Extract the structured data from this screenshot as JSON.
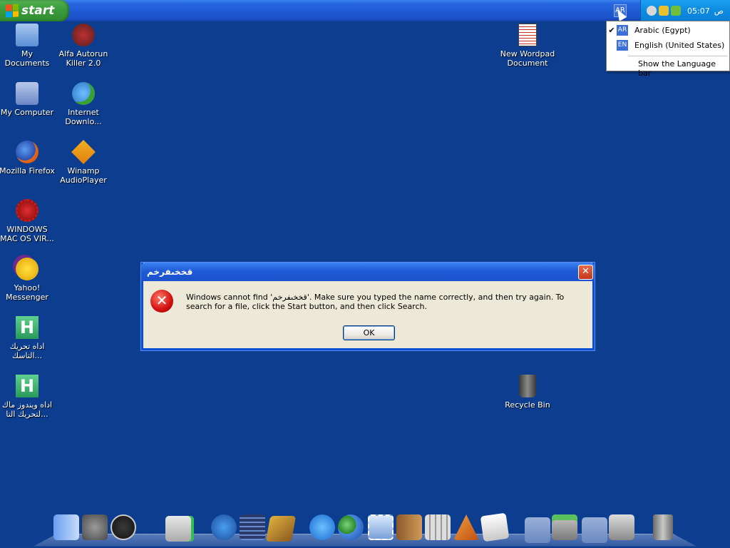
{
  "taskbar": {
    "start_label": "start",
    "language_indicator": "AR",
    "clock": "05:07",
    "clock_ampm": "ص",
    "tray_icons": [
      "messenger-status-icon",
      "network-warning-icon",
      "winamp-tray-icon"
    ]
  },
  "language_menu": {
    "items": [
      {
        "code": "AR",
        "label": "Arabic (Egypt)",
        "checked": true
      },
      {
        "code": "EN",
        "label": "English (United States)",
        "checked": false
      }
    ],
    "show_bar_label": "Show the Language bar"
  },
  "desktop_icons": [
    {
      "label": "My Documents",
      "icon": "folder-documents-icon"
    },
    {
      "label": "Alfa Autorun Killer 2.0",
      "icon": "autorun-killer-icon"
    },
    {
      "label": "My Computer",
      "icon": "computer-icon"
    },
    {
      "label": "Internet Downlo...",
      "icon": "internet-download-icon"
    },
    {
      "label": "Mozilla Firefox",
      "icon": "firefox-icon"
    },
    {
      "label": "Winamp AudioPlayer",
      "icon": "winamp-icon"
    },
    {
      "label": "WINDOWS MAC OS VIR...",
      "icon": "virus-icon"
    },
    {
      "label": "Yahoo! Messenger",
      "icon": "yahoo-messenger-icon"
    },
    {
      "label": "اداه تحريك التاسك...",
      "icon": "h-app-icon"
    },
    {
      "label": "اداه ويندوز ماك لتحريك التا...",
      "icon": "h-app-icon"
    },
    {
      "label": "New Wordpad Document",
      "icon": "wordpad-icon"
    },
    {
      "label": "Recycle Bin",
      "icon": "recycle-bin-icon"
    }
  ],
  "dialog": {
    "title": "قخخىفرخم",
    "message": "Windows cannot find 'قخخىفرخم'. Make sure you typed the name correctly, and then try again. To search for a file, click the Start button, and then click Search.",
    "ok_label": "OK",
    "close_label": "✕",
    "error_symbol": "✕"
  },
  "dock": {
    "items": [
      "finder-icon",
      "system-preferences-icon",
      "power-icon",
      "book-icon",
      "media-player-icon",
      "film-icon",
      "winamp-dock-icon",
      "internet-explorer-icon",
      "messenger-people-icon",
      "mail-stamp-icon",
      "address-book-icon",
      "calculator-icon",
      "applications-icon",
      "notes-icon",
      "folder-down-icon",
      "toolbox-icon",
      "folder-down-icon",
      "downloads-icon",
      "trash-icon"
    ]
  },
  "colors": {
    "desktop": "#0c3d8f",
    "taskbar": "#1f5bd6",
    "start_button": "#3d9e3d",
    "dialog_bg": "#ece9d8",
    "error_red": "#d10f0f"
  }
}
